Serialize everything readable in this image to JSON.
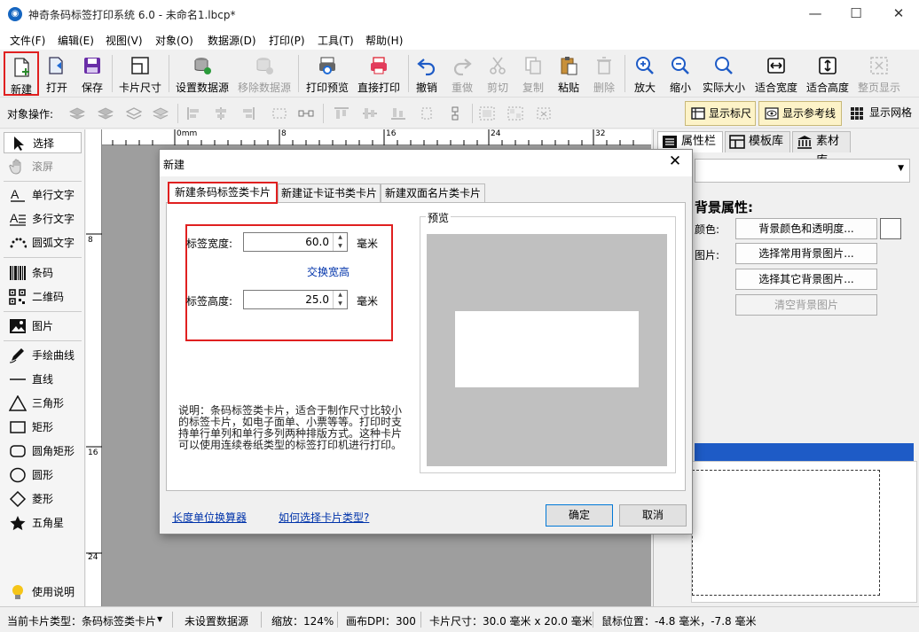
{
  "window": {
    "title": "神奇条码标签打印系统 6.0 - 未命名1.lbcp*",
    "app_icon": "app-logo-icon"
  },
  "menubar": [
    "文件(F)",
    "编辑(E)",
    "视图(V)",
    "对象(O)",
    "数据源(D)",
    "打印(P)",
    "工具(T)",
    "帮助(H)"
  ],
  "toolbar": {
    "new": "新建",
    "open": "打开",
    "save": "保存",
    "card_size": "卡片尺寸",
    "set_datasource": "设置数据源",
    "remove_datasource": "移除数据源",
    "print_preview": "打印预览",
    "direct_print": "直接打印",
    "undo": "撤销",
    "redo": "重做",
    "cut": "剪切",
    "copy": "复制",
    "paste": "粘贴",
    "delete": "删除",
    "zoom_in": "放大",
    "zoom_out": "缩小",
    "actual_size": "实际大小",
    "fit_width": "适合宽度",
    "fit_height": "适合高度",
    "fit_page": "整页显示"
  },
  "objbar": {
    "label": "对象操作:",
    "show_ruler": "显示标尺",
    "show_guides": "显示参考线",
    "show_grid": "显示网格"
  },
  "tools": {
    "select": "选择",
    "pan": "滚屏",
    "single_text": "单行文字",
    "multi_text": "多行文字",
    "arc_text": "圆弧文字",
    "barcode": "条码",
    "qrcode": "二维码",
    "image": "图片",
    "freehand": "手绘曲线",
    "line": "直线",
    "triangle": "三角形",
    "rect": "矩形",
    "roundrect": "圆角矩形",
    "circle": "圆形",
    "diamond": "菱形",
    "star": "五角星",
    "help": "使用说明"
  },
  "ruler": {
    "h": [
      "0mm",
      "8",
      "16",
      "24",
      "32"
    ],
    "v": [
      "8",
      "16",
      "24"
    ]
  },
  "rightpanel": {
    "tabs": [
      "属性栏",
      "模板库",
      "素材库"
    ],
    "section_title": "背景属性:",
    "color_label": "颜色:",
    "image_label": "图片:",
    "btn_bg_color": "背景颜色和透明度...",
    "btn_common_bg": "选择常用背景图片...",
    "btn_other_bg": "选择其它背景图片...",
    "btn_clear_bg": "清空背景图片"
  },
  "dialog": {
    "title": "新建",
    "tabs": [
      "新建条码标签类卡片",
      "新建证卡证书类卡片",
      "新建双面名片类卡片"
    ],
    "width_label": "标签宽度:",
    "width_value": "60.0",
    "unit": "毫米",
    "swap": "交换宽高",
    "height_label": "标签高度:",
    "height_value": "25.0",
    "preview_label": "预览",
    "description": "说明：条码标签类卡片，适合于制作尺寸比较小的标签卡片，如电子面单、小票等等。打印时支持单行单列和单行多列两种排版方式。这种卡片可以使用连续卷纸类型的标签打印机进行打印。",
    "link_unit_calc": "长度单位换算器",
    "link_how_choose": "如何选择卡片类型?",
    "ok": "确定",
    "cancel": "取消"
  },
  "status": {
    "card_type": "当前卡片类型：条码标签类卡片",
    "datasource": "未设置数据源",
    "zoom": "缩放：124%",
    "dpi": "画布DPI：300",
    "card_size": "卡片尺寸：30.0 毫米 x 20.0 毫米",
    "mouse": "鼠标位置：-4.8 毫米，-7.8 毫米"
  },
  "colors": {
    "accent_red": "#e02020",
    "link_blue": "#0033aa",
    "selected_blue": "#1e5bc6"
  }
}
